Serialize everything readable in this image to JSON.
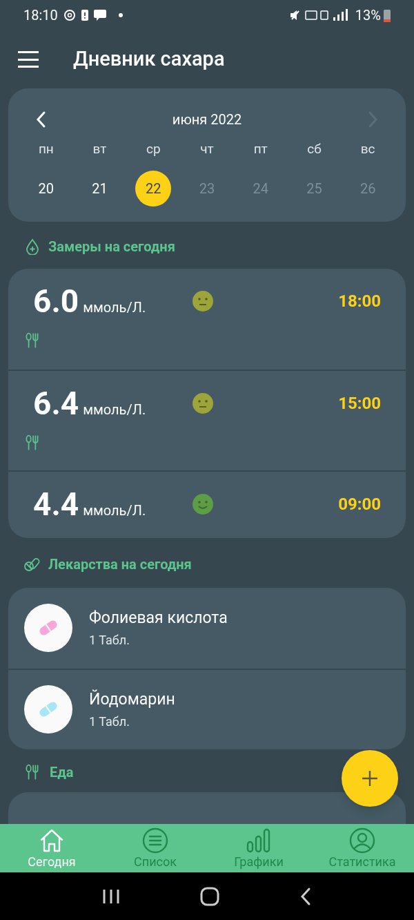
{
  "status_bar": {
    "time": "18:10",
    "battery": "13%"
  },
  "app_bar": {
    "title": "Дневник сахара"
  },
  "calendar": {
    "month": "июня 2022",
    "next_disabled": true,
    "weekdays": [
      "пн",
      "вт",
      "ср",
      "чт",
      "пт",
      "сб",
      "вс"
    ],
    "days": [
      {
        "label": "20",
        "selected": false,
        "disabled": false
      },
      {
        "label": "21",
        "selected": false,
        "disabled": false
      },
      {
        "label": "22",
        "selected": true,
        "disabled": false
      },
      {
        "label": "23",
        "selected": false,
        "disabled": true
      },
      {
        "label": "24",
        "selected": false,
        "disabled": true
      },
      {
        "label": "25",
        "selected": false,
        "disabled": true
      },
      {
        "label": "26",
        "selected": false,
        "disabled": true
      }
    ]
  },
  "readings_section": {
    "title": "Замеры на сегодня"
  },
  "readings": [
    {
      "value": "6.0",
      "unit": "ммоль/Л.",
      "kind": "neutral",
      "color": "#9da43a",
      "time": "18:00",
      "meal": true
    },
    {
      "value": "6.4",
      "unit": "ммоль/Л.",
      "kind": "neutral",
      "color": "#9da43a",
      "time": "15:00",
      "meal": true
    },
    {
      "value": "4.4",
      "unit": "ммоль/Л.",
      "kind": "happy",
      "color": "#5b9e45",
      "time": "09:00",
      "meal": false
    }
  ],
  "medicines_section": {
    "title": "Лекарства на сегодня"
  },
  "medicines": [
    {
      "name": "Фолиевая кислота",
      "dose": "1 Табл.",
      "color": "#f7a8d8"
    },
    {
      "name": "Йодомарин",
      "dose": "1 Табл.",
      "color": "#a8e6f7"
    }
  ],
  "food_section": {
    "title": "Еда"
  },
  "bottom_nav": [
    {
      "label": "Сегодня",
      "kind": "home",
      "selected": true
    },
    {
      "label": "Список",
      "kind": "list",
      "selected": false
    },
    {
      "label": "Графики",
      "kind": "chart",
      "selected": false
    },
    {
      "label": "Статистика",
      "kind": "user",
      "selected": false
    }
  ]
}
